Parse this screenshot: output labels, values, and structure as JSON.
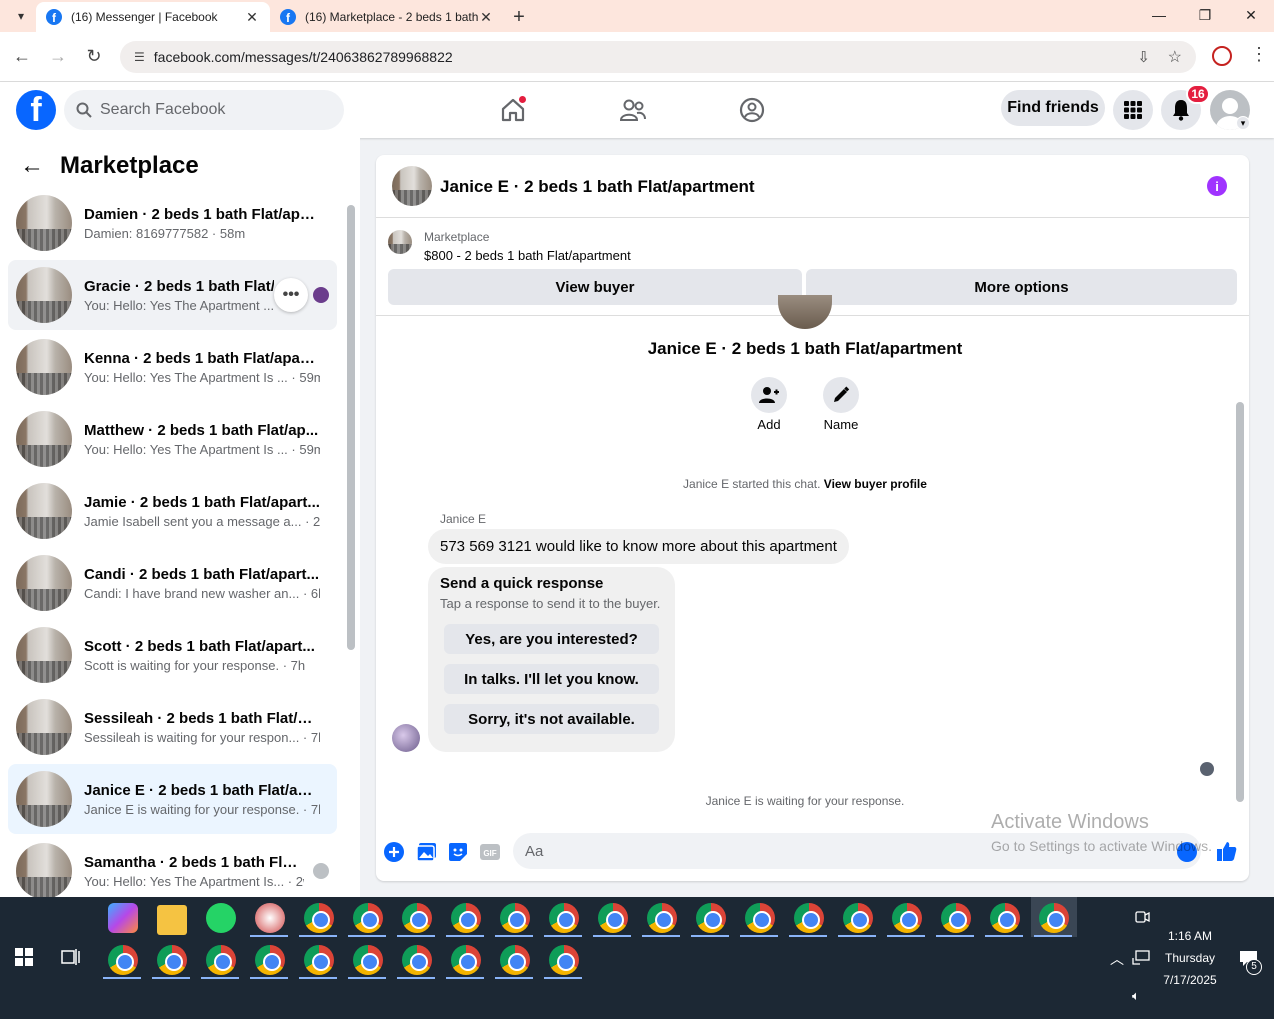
{
  "browser": {
    "tabs": [
      {
        "title": "(16) Messenger | Facebook",
        "active": true
      },
      {
        "title": "(16) Marketplace - 2 beds 1 bath",
        "active": false
      }
    ],
    "url": "facebook.com/messages/t/24063862789968822"
  },
  "header": {
    "search_placeholder": "Search Facebook",
    "find_friends": "Find friends",
    "notification_count": "16"
  },
  "sidebar": {
    "title": "Marketplace",
    "conversations": [
      {
        "name": "Damien · 2 beds 1 bath Flat/apar...",
        "preview": "Damien: 8169777582 · 58m"
      },
      {
        "name": "Gracie · 2 beds 1 bath Flat/ap",
        "preview": "You: Hello: Yes The Apartment ..."
      },
      {
        "name": "Kenna · 2 beds 1 bath Flat/apart...",
        "preview": "You: Hello: Yes The Apartment Is ... · 59m"
      },
      {
        "name": "Matthew · 2 beds 1 bath Flat/ap...",
        "preview": "You: Hello: Yes The Apartment Is ... · 59m"
      },
      {
        "name": "Jamie · 2 beds 1 bath Flat/apart...",
        "preview": "Jamie Isabell sent you a message a... · 2h"
      },
      {
        "name": "Candi · 2 beds 1 bath Flat/apart...",
        "preview": "Candi: I have brand new washer an... · 6h"
      },
      {
        "name": "Scott · 2 beds 1 bath Flat/apart...",
        "preview": "Scott is waiting for your response. · 7h"
      },
      {
        "name": "Sessileah · 2 beds 1 bath Flat/ap...",
        "preview": "Sessileah is waiting for your respon... · 7h"
      },
      {
        "name": "Janice E · 2 beds 1 bath Flat/apar...",
        "preview": "Janice E is waiting for your response. · 7h"
      },
      {
        "name": "Samantha · 2 beds 1 bath Flat...",
        "preview": "You: Hello: Yes The Apartment Is... · 2w"
      }
    ]
  },
  "chat": {
    "title": "Janice E · 2 beds 1 bath Flat/apartment",
    "listing_source": "Marketplace",
    "listing_price": "$800 - 2 beds 1 bath Flat/apartment",
    "view_buyer": "View buyer",
    "more_options": "More options",
    "profile_name": "Janice E · 2 beds 1 bath Flat/apartment",
    "add_label": "Add",
    "name_label": "Name",
    "started_text": "Janice E started this chat. ",
    "view_buyer_profile": "View buyer profile",
    "sender": "Janice E",
    "message": "573 569 3121 would like to know more about this apartment",
    "quick_title": "Send a quick response",
    "quick_sub": "Tap a response to send it to the buyer.",
    "quick_responses": [
      "Yes, are you interested?",
      "In talks. I'll let you know.",
      "Sorry, it's not available."
    ],
    "waiting": "Janice E is waiting for your response.",
    "input_placeholder": "Aa"
  },
  "watermark": {
    "line1": "Activate Windows",
    "line2": "Go to Settings to activate Windows."
  },
  "taskbar": {
    "time": "1:16 AM",
    "day": "Thursday",
    "date": "7/17/2025",
    "notif_count": "5"
  }
}
